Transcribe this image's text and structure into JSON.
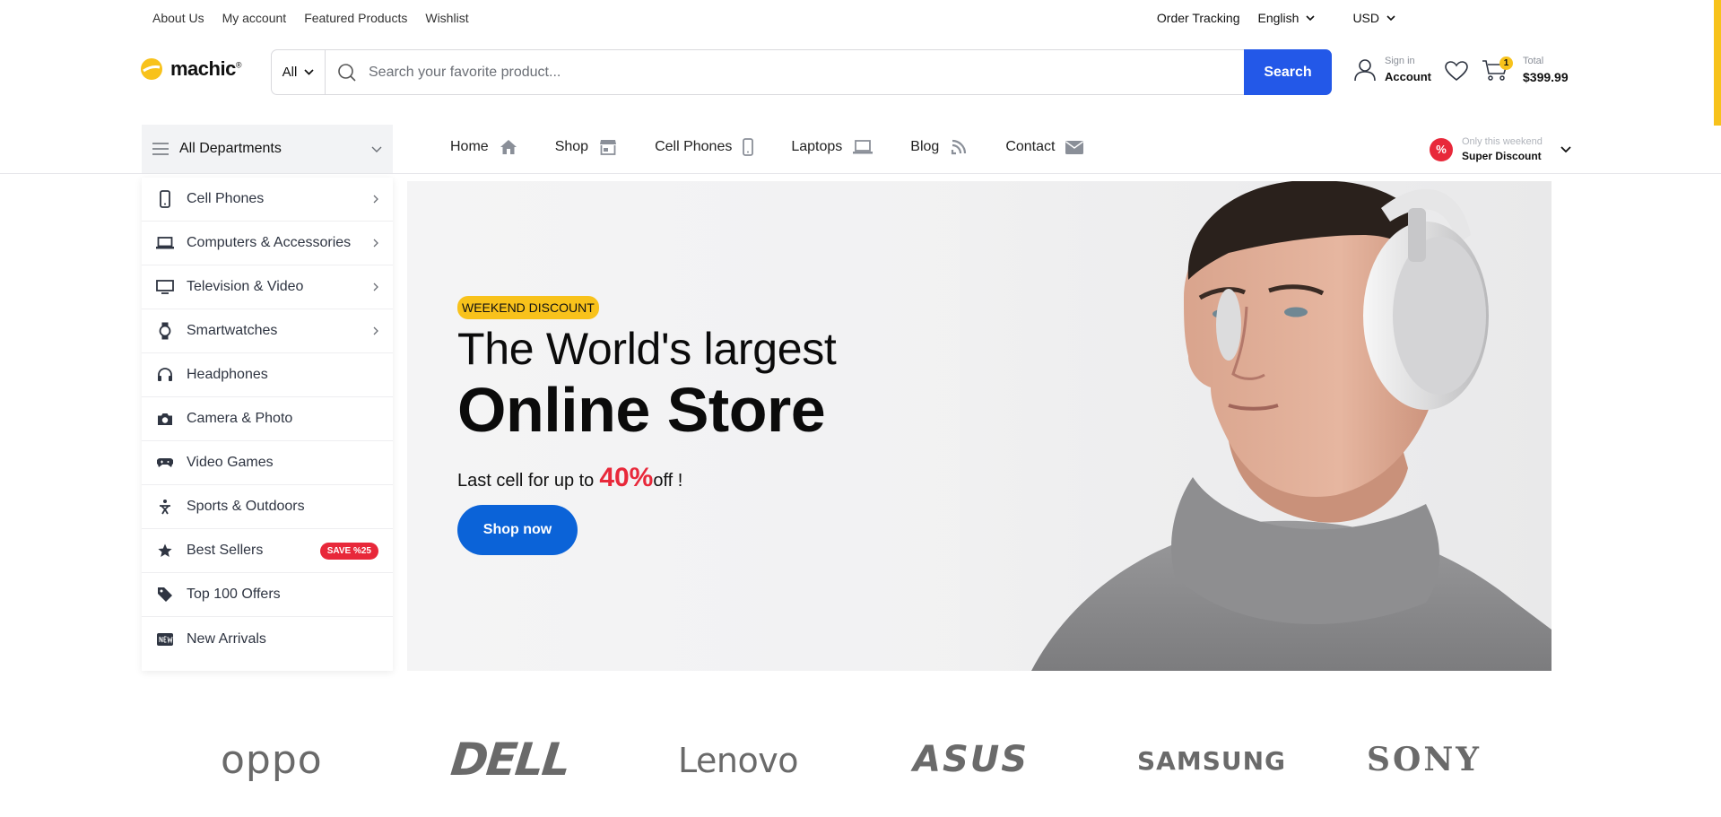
{
  "topbar": {
    "links": [
      "About Us",
      "My account",
      "Featured Products",
      "Wishlist"
    ],
    "order_tracking": "Order Tracking",
    "language": "English",
    "currency": "USD"
  },
  "header": {
    "logo_text": "machic",
    "logo_mark": "®",
    "search": {
      "category": "All",
      "placeholder": "Search your favorite product...",
      "button": "Search"
    },
    "account": {
      "small": "Sign in",
      "big": "Account"
    },
    "cart": {
      "count": "1",
      "small": "Total",
      "total": "$399.99"
    }
  },
  "nav": {
    "all_departments": "All Departments",
    "items": [
      {
        "label": "Home",
        "icon": "home-icon"
      },
      {
        "label": "Shop",
        "icon": "store-icon"
      },
      {
        "label": "Cell Phones",
        "icon": "phone-icon"
      },
      {
        "label": "Laptops",
        "icon": "laptop-icon"
      },
      {
        "label": "Blog",
        "icon": "blog-icon"
      },
      {
        "label": "Contact",
        "icon": "mail-icon"
      }
    ],
    "discount": {
      "badge": "%",
      "small": "Only this weekend",
      "big": "Super Discount"
    }
  },
  "sidebar": {
    "items": [
      {
        "label": "Cell Phones",
        "icon": "phone-icon",
        "arrow": true
      },
      {
        "label": "Computers & Accessories",
        "icon": "laptop-icon",
        "arrow": true
      },
      {
        "label": "Television & Video",
        "icon": "tv-icon",
        "arrow": true
      },
      {
        "label": "Smartwatches",
        "icon": "watch-icon",
        "arrow": true
      },
      {
        "label": "Headphones",
        "icon": "headphones-icon",
        "arrow": false
      },
      {
        "label": "Camera & Photo",
        "icon": "camera-icon",
        "arrow": false
      },
      {
        "label": "Video Games",
        "icon": "gamepad-icon",
        "arrow": false
      },
      {
        "label": "Sports & Outdoors",
        "icon": "sports-icon",
        "arrow": false
      },
      {
        "label": "Best Sellers",
        "icon": "star-icon",
        "arrow": false,
        "badge": "SAVE %25"
      },
      {
        "label": "Top 100 Offers",
        "icon": "tag-icon",
        "arrow": false
      },
      {
        "label": "New Arrivals",
        "icon": "new-icon",
        "arrow": false
      }
    ]
  },
  "hero": {
    "tag": "WEEKEND DISCOUNT",
    "title_line1": "The World's largest",
    "title_line2": "Online Store",
    "sub_before": "Last cell for up to",
    "sub_pct": "40%",
    "sub_after": "off !",
    "button": "Shop now"
  },
  "brands": [
    "oppo",
    "DELL",
    "Lenovo",
    "ASUS",
    "SAMSUNG",
    "SONY"
  ],
  "colors": {
    "accent_blue": "#2358e8",
    "button_blue": "#0b63d8",
    "yellow": "#f8c21b",
    "red": "#e8283a"
  }
}
